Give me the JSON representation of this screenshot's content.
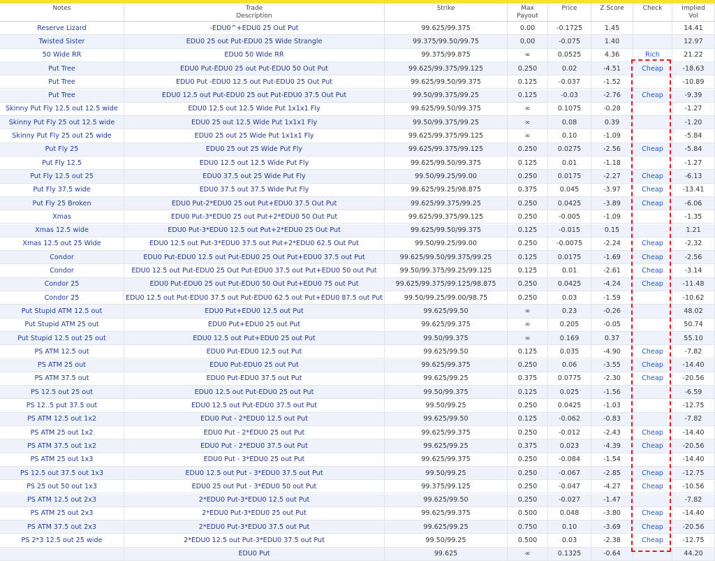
{
  "headers": [
    "Notes",
    "Trade\nDescription",
    "Strike",
    "Max\nPayout",
    "Price",
    "Z Score",
    "Check",
    "Implied\nVol"
  ],
  "rows": [
    [
      "Reserve Lizard",
      "-EDU0^+EDU0 25 Out Put",
      "99.625/99.375",
      "0.00",
      "-0.1725",
      "1.45",
      "",
      "14.41"
    ],
    [
      "Twisted Sister",
      "EDU0 25 out Put-EDU0 25 Wide Strangle",
      "99.375/99.50/99.75",
      "0.00",
      "-0.075",
      "1.40",
      "",
      "12.97"
    ],
    [
      "50 Wide RR",
      "EDU0 50 Wide RR",
      "99.375/99.875",
      "∞",
      "0.0525",
      "4.36",
      "Rich",
      "21.22"
    ],
    [
      "Put Tree",
      "EDU0 Put-EDU0 25 out Put-EDU0 50 Out Put",
      "99.625/99.375/99.125",
      "0.250",
      "0.02",
      "-4.51",
      "Cheap",
      "-18.63"
    ],
    [
      "Put Tree",
      "EDU0 Put -EDU0 12.5 out Put-EDU0 25 Out Put",
      "99.625/99.50/99.375",
      "0.125",
      "-0.037",
      "-1.52",
      "",
      "-10.89"
    ],
    [
      "Put Tree",
      "EDU0 12.5 out Put-EDU0 25 out Put-EDU0 37.5 Out Put",
      "99.50/99.375/99.25",
      "0.125",
      "-0.03",
      "-2.76",
      "Cheap",
      "-9.39"
    ],
    [
      "Skinny Put Fly 12.5 out 12.5 wide",
      "EDU0 12.5 out 12.5 Wide Put 1x1x1 Fly",
      "99.625/99.50/99.375",
      "∞",
      "0.1075",
      "-0.28",
      "",
      "-1.27"
    ],
    [
      "Skinny Put Fly 25 out 12.5 wide",
      "EDU0 25 out 12.5 Wide Put 1x1x1 Fly",
      "99.50/99.375/99.25",
      "∞",
      "0.08",
      "0.39",
      "",
      "-1.20"
    ],
    [
      "Skinny Put Fly 25 out 25 wide",
      "EDU0 25 out 25 Wide Put 1x1x1 Fly",
      "99.625/99.375/99.125",
      "∞",
      "0.10",
      "-1.09",
      "",
      "-5.84"
    ],
    [
      "Put Fly 25",
      "EDU0 25 out 25 Wide Put Fly",
      "99.625/99.375/99.125",
      "0.250",
      "0.0275",
      "-2.56",
      "Cheap",
      "-5.84"
    ],
    [
      "Put Fly 12.5",
      "EDU0 12.5 out 12.5 Wide Put Fly",
      "99.625/99.50/99.375",
      "0.125",
      "0.01",
      "-1.18",
      "",
      "-1.27"
    ],
    [
      "Put Fly 12.5 out 25",
      "EDU0 37.5 out 25 Wide Put Fly",
      "99.50/99.25/99.00",
      "0.250",
      "0.0175",
      "-2.27",
      "Cheap",
      "-6.13"
    ],
    [
      "Put Fly 37.5 wide",
      "EDU0 37.5 out 37.5 Wide Put Fly",
      "99.625/99.25/98.875",
      "0.375",
      "0.045",
      "-3.97",
      "Cheap",
      "-13.41"
    ],
    [
      "Put Fly 25 Broken",
      "EDU0 Put-2*EDU0 25 out Put+EDU0 37.5 Out Put",
      "99.625/99.375/99.25",
      "0.250",
      "0.0425",
      "-3.89",
      "Cheap",
      "-6.06"
    ],
    [
      "Xmas",
      "EDU0 Put-3*EDU0 25 out Put+2*EDU0 50 Out Put",
      "99.625/99.375/99.125",
      "0.250",
      "-0.005",
      "-1.09",
      "",
      "-1.35"
    ],
    [
      "Xmas 12.5 wide",
      "EDU0 Put-3*EDU0 12.5 out Put+2*EDU0 25 Out Put",
      "99.625/99.50/99.375",
      "0.125",
      "-0.015",
      "0.15",
      "",
      "1.21"
    ],
    [
      "Xmas 12.5 out 25 Wide",
      "EDU0 12.5 out Put-3*EDU0 37.5 out Put+2*EDU0 62.5 Out Put",
      "99.50/99.25/99.00",
      "0.250",
      "-0.0075",
      "-2.24",
      "Cheap",
      "-2.32"
    ],
    [
      "Condor",
      "EDU0 Put-EDU0 12.5 out Put-EDU0 25 Out Put+EDU0 37.5 out Put",
      "99.625/99.50/99.375/99.25",
      "0.125",
      "0.0175",
      "-1.69",
      "Cheap",
      "-2.56"
    ],
    [
      "Condor",
      "EDU0 12.5 out Put-EDU0 25 Out Put-EDU0 37.5 out Put+EDU0 50 out Put",
      "99.50/99.375/99.25/99.125",
      "0.125",
      "0.01",
      "-2.61",
      "Cheap",
      "-3.14"
    ],
    [
      "Condor 25",
      "EDU0 Put-EDU0 25 out Put-EDU0 50 Out Put+EDU0 75 out Put",
      "99.625/99.375/99.125/98.875",
      "0.250",
      "0.0425",
      "-4.24",
      "Cheap",
      "-11.48"
    ],
    [
      "Condor 25",
      "EDU0 12.5 out Put-EDU0 37.5 out Put-EDU0 62.5 out Put+EDU0 87.5 out Put",
      "99.50/99.25/99.00/98.75",
      "0.250",
      "0.03",
      "-1.59",
      "",
      "-10.62"
    ],
    [
      "Put Stupid ATM 12.5 out",
      "EDU0 Put+EDU0 12.5 out Put",
      "99.625/99.50",
      "∞",
      "0.23",
      "-0.26",
      "",
      "48.02"
    ],
    [
      "Put Stupid ATM 25 out",
      "EDU0 Put+EDU0 25 out Put",
      "99.625/99.375",
      "∞",
      "0.205",
      "-0.05",
      "",
      "50.74"
    ],
    [
      "Put Stupid 12.5 out 25 out",
      "EDU0 12.5 out Put+EDU0 25 out Put",
      "99.50/99.375",
      "∞",
      "0.169",
      "0.37",
      "",
      "55.10"
    ],
    [
      "PS ATM 12.5 out",
      "EDU0 Put-EDU0 12.5 out Put",
      "99.625/99.50",
      "0.125",
      "0.035",
      "-4.90",
      "Cheap",
      "-7.82"
    ],
    [
      "PS ATM 25 out",
      "EDU0 Put-EDU0 25 out Put",
      "99.625/99.375",
      "0.250",
      "0.06",
      "-3.55",
      "Cheap",
      "-14.40"
    ],
    [
      "PS ATM 37.5 out",
      "EDU0 Put-EDU0 37.5 out Put",
      "99.625/99.25",
      "0.375",
      "0.0775",
      "-2.30",
      "Cheap",
      "-20.56"
    ],
    [
      "PS 12.5 out 25 out",
      "EDU0 12.5 out Put-EDU0 25 out Put",
      "99.50/99.375",
      "0.125",
      "0.025",
      "-1.56",
      "",
      "-6.59"
    ],
    [
      "PS 12..5 put 37.5 out",
      "EDU0 12.5 out Put-EDU0 37.5 out Put",
      "99.50/99.25",
      "0.250",
      "0.0425",
      "-1.03",
      "",
      "-12.75"
    ],
    [
      "PS ATM 12.5 out 1x2",
      "EDU0 Put - 2*EDU0 12.5 out Put",
      "99.625/99.50",
      "0.125",
      "-0.062",
      "-0.83",
      "",
      "-7.82"
    ],
    [
      "PS ATM 25 out 1x2",
      "EDU0 Put - 2*EDU0 25 out Put",
      "99.625/99.375",
      "0.250",
      "-0.012",
      "-2.43",
      "Cheap",
      "-14.40"
    ],
    [
      "PS ATM 37.5 out 1x2",
      "EDU0 Put - 2*EDU0 37.5 out Put",
      "99.625/99.25",
      "0.375",
      "0.023",
      "-4.39",
      "Cheap",
      "-20.56"
    ],
    [
      "PS ATM 25 out 1x3",
      "EDU0 Put - 3*EDU0 25 out Put",
      "99.625/99.375",
      "0.250",
      "-0.084",
      "-1.54",
      "",
      "-14.40"
    ],
    [
      "PS 12.5 out 37.5 out 1x3",
      "EDU0 12.5 out Put - 3*EDU0 37.5 out Put",
      "99.50/99.25",
      "0.250",
      "-0.067",
      "-2.85",
      "Cheap",
      "-12.75"
    ],
    [
      "PS 25 out 50 out 1x3",
      "EDU0 25 out Put - 3*EDU0 50 out Put",
      "99.375/99.125",
      "0.250",
      "-0.047",
      "-4.27",
      "Cheap",
      "-10.56"
    ],
    [
      "PS ATM 12.5 out 2x3",
      "2*EDU0 Put-3*EDU0 12.5 out Put",
      "99.625/99.50",
      "0.250",
      "-0.027",
      "-1.47",
      "",
      "-7.82"
    ],
    [
      "PS ATM 25 out 2x3",
      "2*EDU0 Put-3*EDU0 25 out Put",
      "99.625/99.375",
      "0.500",
      "0.048",
      "-3.80",
      "Cheap",
      "-14.40"
    ],
    [
      "PS ATM 37.5 out 2x3",
      "2*EDU0 Put-3*EDU0 37.5 out Put",
      "99.625/99.25",
      "0.750",
      "0.10",
      "-3.69",
      "Cheap",
      "-20.56"
    ],
    [
      "PS 2*3 12.5 out 25 wide",
      "2*EDU0 12.5 out Put-3*EDU0 37.5 out Put",
      "99.50/99.25",
      "0.500",
      "0.03",
      "-2.38",
      "Cheap",
      "-12.75"
    ],
    [
      "",
      "EDU0 Put",
      "99.625",
      "∞",
      "0.1325",
      "-0.64",
      "",
      "44.20"
    ]
  ]
}
